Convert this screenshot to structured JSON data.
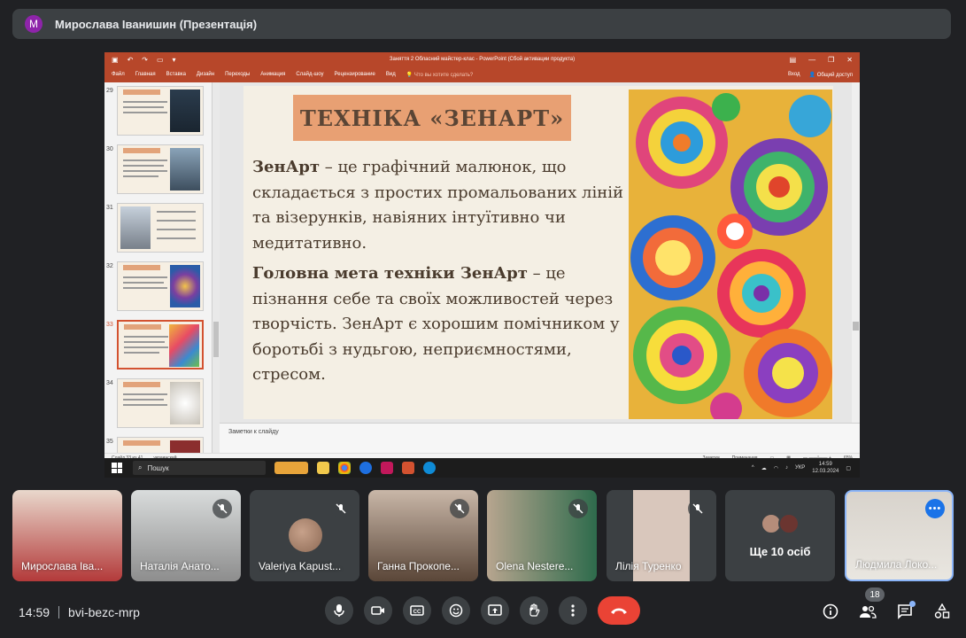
{
  "presenter": {
    "initial": "M",
    "name": "Мирослава Іванишин (Презентація)"
  },
  "ppt": {
    "doc_title": "Заняття 2 Обласний майстер-клас - PowerPoint (Сбой активации продукта)",
    "ribbon_tabs": [
      "Файл",
      "Главная",
      "Вставка",
      "Дизайн",
      "Переходы",
      "Анимация",
      "Слайд-шоу",
      "Рецензирование",
      "Вид"
    ],
    "tell_me": "Что вы хотите сделать?",
    "sign_in": "Вход",
    "share": "Общий доступ",
    "thumb_numbers": [
      "29",
      "30",
      "31",
      "32",
      "33",
      "34",
      "35"
    ],
    "slide": {
      "title": "ТЕХНІКА «ЗЕНАРТ»",
      "p1_bold": "ЗенАрт",
      "p1_rest": " – це графічний малюнок, що складається з простих промальованих ліній та візерунків, навіяних інтуїтивно чи медитативно.",
      "p2_bold": "Головна мета техніки ЗенАрт",
      "p2_rest": " – це пізнання себе та своїх можливостей через творчість. ЗенАрт є хорошим помічником у боротьбі з нудьгою, неприємностями, стресом."
    },
    "notes_placeholder": "Заметки к слайду",
    "status_slide": "Слайд 33 из 41",
    "status_lang": "украинский",
    "status_notes": "Заметки",
    "status_comments": "Примечания",
    "zoom": "65%"
  },
  "taskbar": {
    "search": "Пошук",
    "lang": "УКР",
    "time": "14:59",
    "date": "12.03.2024"
  },
  "participants": [
    {
      "name": "Мирослава Іва...",
      "muted": false
    },
    {
      "name": "Наталія Анато...",
      "muted": true
    },
    {
      "name": "Valeriya Kapust...",
      "muted": true
    },
    {
      "name": "Ганна Прокопе...",
      "muted": true
    },
    {
      "name": "Olena Nestere...",
      "muted": true
    },
    {
      "name": "Лілія Туренко",
      "muted": true
    },
    {
      "name": "Ще 10 осіб",
      "muted": false
    },
    {
      "name": "Людмила Локо...",
      "muted": false
    }
  ],
  "more_menu": "•••",
  "meeting": {
    "time": "14:59",
    "code": "bvi-bezc-mrp"
  },
  "people_count": "18",
  "colors": {
    "end_call": "#ea4335",
    "ppt_ribbon": "#b7472a",
    "active_border": "#8ab4f8",
    "title_box": "#e8a073"
  }
}
